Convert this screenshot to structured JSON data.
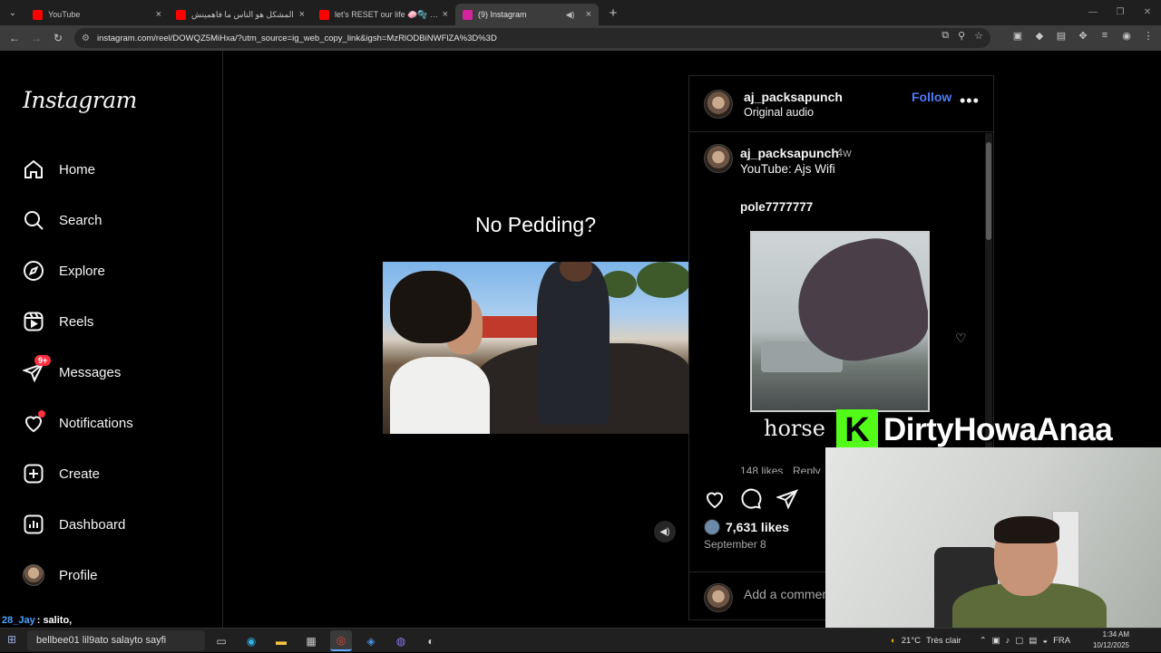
{
  "browser": {
    "tabs": [
      {
        "title": "YouTube",
        "color": "#ff0000"
      },
      {
        "title": "المشكل هو الناس ما فاهمينش",
        "color": "#ff0000"
      },
      {
        "title": "let's RESET our life 🧼🫧 البرد",
        "color": "#ff0000"
      },
      {
        "title": "(9) Instagram",
        "color": "#d6249f",
        "active": true
      }
    ],
    "url": "instagram.com/reel/DOWQZ5MiHxa/?utm_source=ig_web_copy_link&igsh=MzRlODBiNWFlZA%3D%3D"
  },
  "sidebar": {
    "logo": "Instagram",
    "items": [
      {
        "label": "Home",
        "icon": "home-icon"
      },
      {
        "label": "Search",
        "icon": "search-icon"
      },
      {
        "label": "Explore",
        "icon": "compass-icon"
      },
      {
        "label": "Reels",
        "icon": "reels-icon"
      },
      {
        "label": "Messages",
        "icon": "messenger-icon",
        "badge": "9+"
      },
      {
        "label": "Notifications",
        "icon": "heart-icon"
      },
      {
        "label": "Create",
        "icon": "plus-square-icon"
      },
      {
        "label": "Dashboard",
        "icon": "chart-icon"
      },
      {
        "label": "Profile",
        "icon": "avatar"
      }
    ]
  },
  "reel": {
    "caption": "No Pedding?"
  },
  "post": {
    "author": "aj_packsapunch",
    "audio": "Original audio",
    "follow_label": "Follow",
    "comment": {
      "author": "aj_packsapunch",
      "time": "4w",
      "text": "YouTube: Ajs Wifi",
      "mention": "pole7777777",
      "gif_caption": "horse",
      "likes": "148 likes",
      "reply": "Reply"
    },
    "likes": "7,631 likes",
    "date": "September 8",
    "add_comment_placeholder": "Add a comment..."
  },
  "stream": {
    "name": "DirtyHowaAnaa",
    "platform_letter": "K",
    "platform_color": "#53fc18",
    "chat_user": "28_Jay",
    "chat_text": ": salito,"
  },
  "taskbar": {
    "search_text": "bellbee01 lil9ato salayto sayfi",
    "weather": "21°C",
    "weather_desc": "Très clair",
    "lang": "FRA",
    "time": "1:34 AM",
    "date": "10/12/2025"
  }
}
